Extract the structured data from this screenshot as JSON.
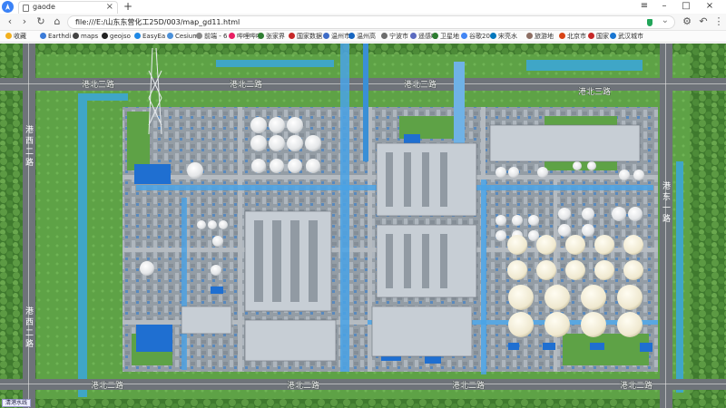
{
  "browser": {
    "tab_title": "gaode",
    "tab_close": "×",
    "new_tab": "+",
    "url": "file:///E:/山东东营化工25D/003/map_gd11.html",
    "window_controls": {
      "menu": "≡",
      "minimize": "–",
      "maximize": "□",
      "close": "×"
    },
    "nav_icons": [
      "back-arrow-icon",
      "forward-arrow-icon",
      "refresh-icon",
      "home-icon"
    ]
  },
  "bookmarks": [
    {
      "label": "收藏",
      "color": "#f2b01e"
    },
    {
      "label": "Earthdi",
      "color": "#3b7bd8"
    },
    {
      "label": "maps",
      "color": "#444444"
    },
    {
      "label": "geojso",
      "color": "#222222"
    },
    {
      "label": "EasyEa",
      "color": "#1e88e5"
    },
    {
      "label": "Cesium",
      "color": "#4a90d9"
    },
    {
      "label": "前端 - 6",
      "color": "#888888"
    },
    {
      "label": "哔哩哔哩",
      "color": "#e91e63"
    },
    {
      "label": "张家界",
      "color": "#2e7d32"
    },
    {
      "label": "国家数据",
      "color": "#c62828"
    },
    {
      "label": "温州市",
      "color": "#3e6cc7"
    },
    {
      "label": "温州高",
      "color": "#1565c0"
    },
    {
      "label": "宁波市",
      "color": "#6d6d6d"
    },
    {
      "label": "遥感吧",
      "color": "#5c6bc0"
    },
    {
      "label": "卫星地",
      "color": "#2e7d32"
    },
    {
      "label": "谷歌20",
      "color": "#4285f4"
    },
    {
      "label": "宋亮水",
      "color": "#0277bd"
    },
    {
      "label": "旅游地",
      "color": "#8d6e63"
    },
    {
      "label": "北京市",
      "color": "#d84315"
    },
    {
      "label": "国家",
      "color": "#c62828"
    },
    {
      "label": "武汉城市",
      "color": "#1976d2"
    }
  ],
  "map": {
    "road_labels": {
      "north_left": "港北三路",
      "north_right": "港北三路",
      "north_mid": "港北二路",
      "west_upper": "港西二路",
      "west_lower": "港西二路",
      "east": "港东一路",
      "south_left": "港北二路",
      "south_mid1": "港北二路",
      "south_mid2": "港北二路",
      "south_right": "港北二路"
    },
    "colors": {
      "grass": "#4f8a3a",
      "road": "#6e7379",
      "water": "#3fa6c7",
      "pipe": "#4aa3e6",
      "tank": "#eef0f2",
      "building_blue": "#1f6fd1"
    }
  },
  "status_chip": "清港水线"
}
